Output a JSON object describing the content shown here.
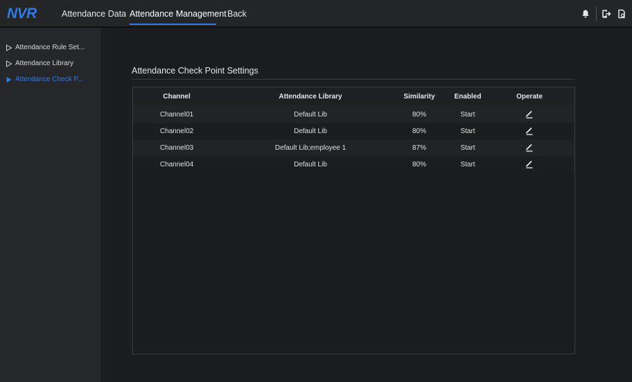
{
  "app": {
    "logo": "NVR"
  },
  "nav": {
    "items": [
      {
        "label": "Attendance Data"
      },
      {
        "label": "Attendance Management"
      },
      {
        "label": "Back"
      }
    ]
  },
  "topbar_icons": [
    "bell-icon",
    "logout-icon",
    "document-icon"
  ],
  "sidebar": {
    "items": [
      {
        "label": "Attendance Rule Set..."
      },
      {
        "label": "Attendance Library"
      },
      {
        "label": "Attendance Check P..."
      }
    ]
  },
  "section": {
    "title": "Attendance Check Point Settings"
  },
  "table": {
    "headers": [
      "Channel",
      "Attendance Library",
      "Similarity",
      "Enabled",
      "Operate"
    ],
    "rows": [
      {
        "channel": "Channel01",
        "library": "Default Lib",
        "similarity": "80%",
        "enabled": "Start"
      },
      {
        "channel": "Channel02",
        "library": "Default Lib",
        "similarity": "80%",
        "enabled": "Start"
      },
      {
        "channel": "Channel03",
        "library": "Default Lib;employee 1",
        "similarity": "87%",
        "enabled": "Start"
      },
      {
        "channel": "Channel04",
        "library": "Default Lib",
        "similarity": "80%",
        "enabled": "Start"
      }
    ]
  },
  "colors": {
    "accent": "#2f7be8",
    "background": "#1c1d1f",
    "sidebar": "#26272a"
  }
}
